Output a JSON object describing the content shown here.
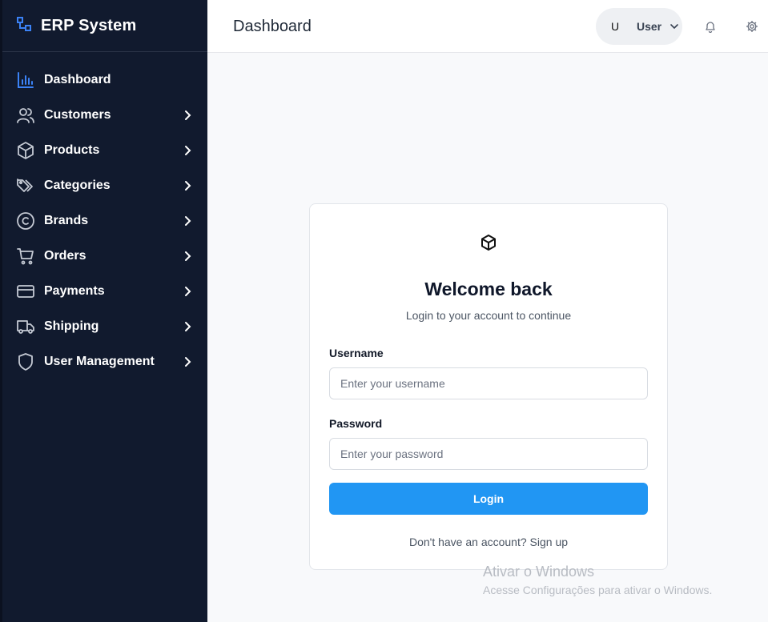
{
  "app": {
    "title": "ERP System"
  },
  "colors": {
    "sidebar_bg": "#111a2e",
    "accent": "#2196f3",
    "active_icon": "#3b82f6"
  },
  "sidebar": {
    "items": [
      {
        "label": "Dashboard",
        "icon": "bar-chart-icon",
        "active": true,
        "has_submenu": false
      },
      {
        "label": "Customers",
        "icon": "users-icon",
        "has_submenu": true
      },
      {
        "label": "Products",
        "icon": "box-icon",
        "has_submenu": true
      },
      {
        "label": "Categories",
        "icon": "tags-icon",
        "has_submenu": true
      },
      {
        "label": "Brands",
        "icon": "copyright-icon",
        "has_submenu": true
      },
      {
        "label": "Orders",
        "icon": "cart-icon",
        "has_submenu": true
      },
      {
        "label": "Payments",
        "icon": "credit-card-icon",
        "has_submenu": true
      },
      {
        "label": "Shipping",
        "icon": "truck-icon",
        "has_submenu": true
      },
      {
        "label": "User Management",
        "icon": "shield-icon",
        "has_submenu": true
      }
    ]
  },
  "header": {
    "title": "Dashboard",
    "user": {
      "initial": "U",
      "name": "User"
    },
    "icons": [
      "bell-icon",
      "gear-icon"
    ]
  },
  "login": {
    "title": "Welcome back",
    "subtitle": "Login to your account to continue",
    "username_label": "Username",
    "username_placeholder": "Enter your username",
    "username_value": "",
    "password_label": "Password",
    "password_placeholder": "Enter your password",
    "password_value": "",
    "button_label": "Login",
    "signup_prompt": "Don't have an account?",
    "signup_link": "Sign up"
  },
  "watermark": {
    "title": "Ativar o Windows",
    "subtitle": "Acesse Configurações para ativar o Windows."
  }
}
